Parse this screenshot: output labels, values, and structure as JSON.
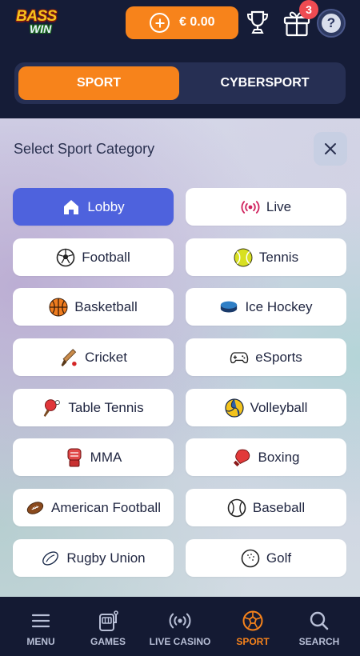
{
  "header": {
    "logo_top": "BASS",
    "logo_bottom": "WIN",
    "balance": "€ 0.00",
    "gift_badge": "3",
    "help_icon": "?"
  },
  "switcher": {
    "tabs": [
      {
        "label": "SPORT",
        "active": true
      },
      {
        "label": "CYBERSPORT",
        "active": false
      }
    ]
  },
  "panel": {
    "title": "Select Sport Category",
    "categories": [
      {
        "label": "Lobby",
        "icon": "home-icon",
        "active": true
      },
      {
        "label": "Live",
        "icon": "live-icon"
      },
      {
        "label": "Football",
        "icon": "football-icon"
      },
      {
        "label": "Tennis",
        "icon": "tennis-ball-icon"
      },
      {
        "label": "Basketball",
        "icon": "basketball-icon"
      },
      {
        "label": "Ice Hockey",
        "icon": "hockey-puck-icon"
      },
      {
        "label": "Cricket",
        "icon": "cricket-icon"
      },
      {
        "label": "eSports",
        "icon": "gamepad-icon"
      },
      {
        "label": "Table Tennis",
        "icon": "table-tennis-icon"
      },
      {
        "label": "Volleyball",
        "icon": "volleyball-icon"
      },
      {
        "label": "MMA",
        "icon": "mma-glove-icon"
      },
      {
        "label": "Boxing",
        "icon": "boxing-glove-icon"
      },
      {
        "label": "American Football",
        "icon": "american-football-icon"
      },
      {
        "label": "Baseball",
        "icon": "baseball-icon"
      },
      {
        "label": "Rugby Union",
        "icon": "rugby-ball-icon"
      },
      {
        "label": "Golf",
        "icon": "golf-ball-icon"
      }
    ]
  },
  "bottom_nav": {
    "items": [
      {
        "label": "MENU",
        "icon": "hamburger-menu-icon"
      },
      {
        "label": "GAMES",
        "icon": "slot-machine-icon"
      },
      {
        "label": "LIVE CASINO",
        "icon": "live-broadcast-icon"
      },
      {
        "label": "SPORT",
        "icon": "soccer-ball-icon",
        "active": true
      },
      {
        "label": "SEARCH",
        "icon": "search-icon"
      }
    ]
  },
  "colors": {
    "accent_orange": "#f7831b",
    "active_blue": "#4e62dd",
    "dark_bg": "#141b35",
    "badge_red": "#ef4b52"
  }
}
